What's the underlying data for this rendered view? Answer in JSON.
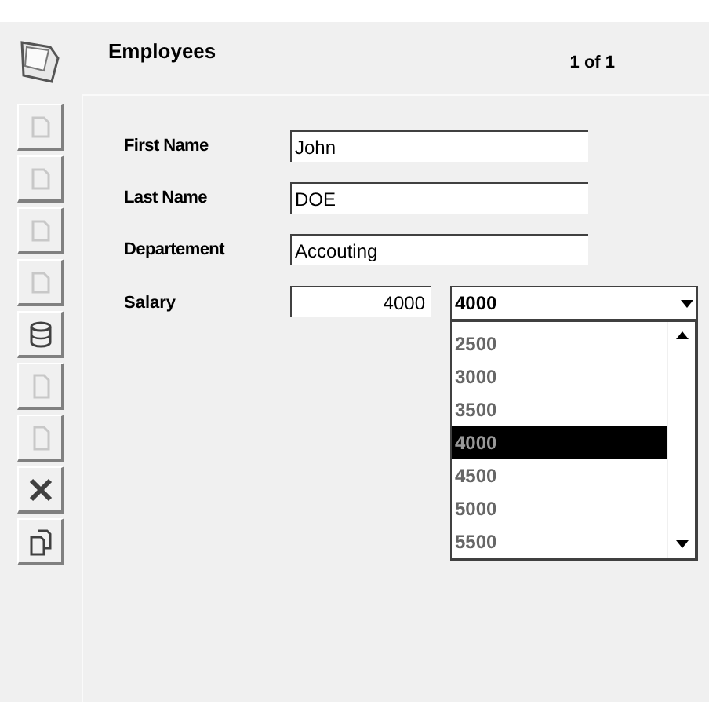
{
  "header": {
    "title": "Employees",
    "record_counter": "1 of 1"
  },
  "toolbar": [
    {
      "kind": "first",
      "disabled": true
    },
    {
      "kind": "prev",
      "disabled": true
    },
    {
      "kind": "next",
      "disabled": true
    },
    {
      "kind": "last",
      "disabled": true
    },
    {
      "kind": "database",
      "disabled": false
    },
    {
      "kind": "save",
      "disabled": true
    },
    {
      "kind": "cancel",
      "disabled": true
    },
    {
      "kind": "delete",
      "disabled": false
    },
    {
      "kind": "copy",
      "disabled": false
    }
  ],
  "fields": [
    {
      "label": "First Name",
      "value": "John"
    },
    {
      "label": "Last Name",
      "value": "DOE"
    },
    {
      "label": "Departement",
      "value": "Accouting"
    }
  ],
  "salary": {
    "label": "Salary",
    "value": "4000",
    "combo_value": "4000",
    "options": [
      {
        "text": "2500",
        "selected": false
      },
      {
        "text": "3000",
        "selected": false
      },
      {
        "text": "3500",
        "selected": false
      },
      {
        "text": "4000",
        "selected": true
      },
      {
        "text": "4500",
        "selected": false
      },
      {
        "text": "5000",
        "selected": false
      },
      {
        "text": "5500",
        "selected": false
      }
    ]
  }
}
